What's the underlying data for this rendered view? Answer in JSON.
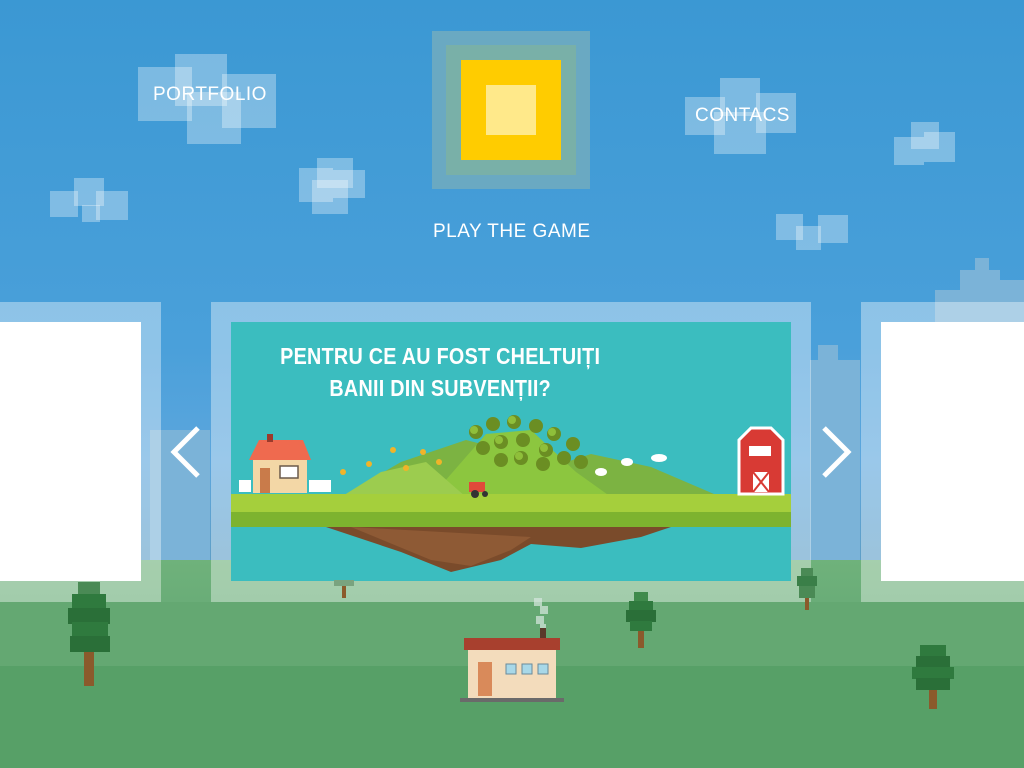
{
  "nav": {
    "portfolio": "PORTFOLIO",
    "contacts": "CONTACS",
    "play": "PLAY THE GAME"
  },
  "slider": {
    "title_line1": "PENTRU CE AU FOST CHELTUIȚI",
    "title_line2": "BANII DIN SUBVENȚII?",
    "prev_icon": "chevron-left-icon",
    "next_icon": "chevron-right-icon"
  },
  "colors": {
    "sky": "#3b98d3",
    "logo_yellow": "#ffcc00",
    "slide_teal": "#3bbdbf",
    "grass": "#8cc63f",
    "barn_red": "#d83a34"
  }
}
